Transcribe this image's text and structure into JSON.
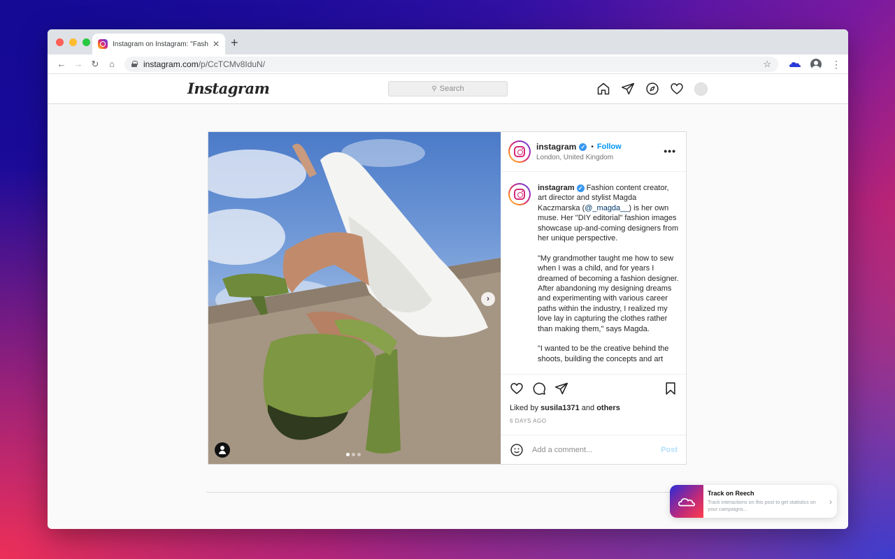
{
  "browser": {
    "tab_title": "Instagram on Instagram: \"Fash",
    "tab_close": "✕",
    "new_tab": "+",
    "url_domain": "instagram.com",
    "url_path": "/p/CcTCMv8IduN/",
    "back": "←",
    "forward": "→",
    "reload": "↻",
    "home": "⌂",
    "bookmark_star": "☆",
    "menu": "⋮",
    "extension_icon": "reech-cloud-icon"
  },
  "ig_header": {
    "logo": "Instagram",
    "search_placeholder": "Search",
    "nav_icons": [
      "home-icon",
      "direct-icon",
      "explore-icon",
      "activity-heart-icon",
      "profile-avatar"
    ]
  },
  "post": {
    "username": "instagram",
    "verified": "✓",
    "separator": "•",
    "follow_label": "Follow",
    "location": "London, United Kingdom",
    "more": "•••",
    "caption_username": "instagram",
    "caption_p1_before": "Fashion content creator, art director and stylist Magda Kaczmarska (",
    "caption_mention": "@_magda__",
    "caption_p1_after": ") is her own muse. Her \"DIY editorial\" fashion images showcase up-and-coming designers from her unique perspective.",
    "caption_p2": "\"My grandmother taught me how to sew when I was a child, and for years I dreamed of becoming a fashion designer. After abandoning my designing dreams and experimenting with various career paths within the industry, I realized my love lay in capturing the clothes rather than making them,\" says Magda.",
    "caption_p3": "\"I wanted to be the creative behind the shoots, building the concepts and art",
    "liked_prefix": "Liked by",
    "liked_user": "susila1371",
    "liked_and": "and",
    "liked_others": "others",
    "time_ago": "6 DAYS AGO",
    "comment_placeholder": "Add a comment...",
    "post_button": "Post",
    "carousel_next": "›",
    "carousel_count": 3,
    "carousel_active": 1
  },
  "reech": {
    "title": "Track on Reech",
    "subtitle": "Track interactions on this post to get statistics on your campaigns...",
    "chevron": "›"
  },
  "colors": {
    "follow_blue": "#0095f6",
    "verified_blue": "#3897f0",
    "mention": "#00376b"
  }
}
